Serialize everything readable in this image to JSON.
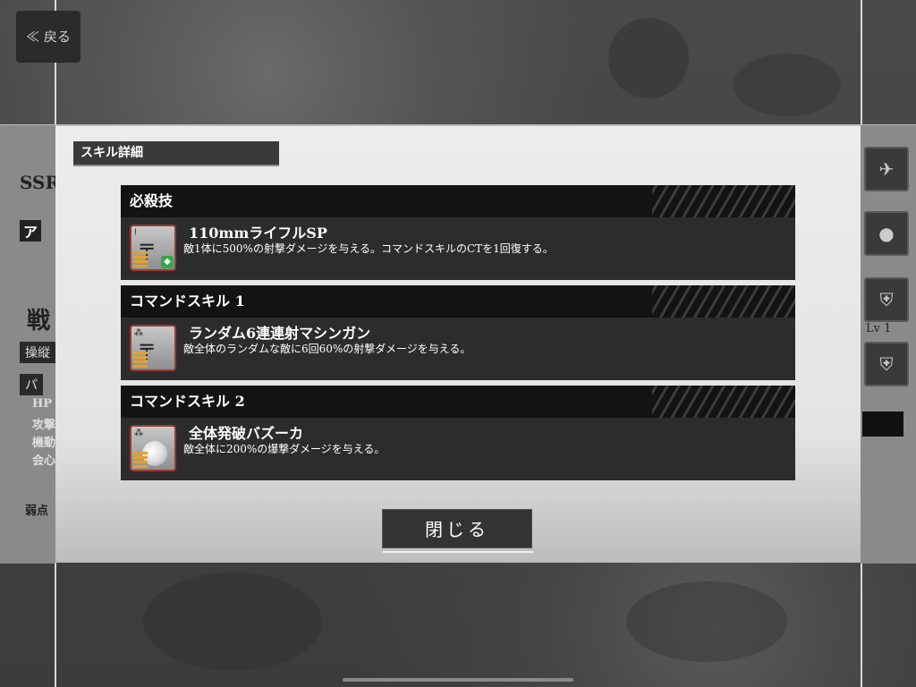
{
  "background": {
    "back_label": "≪ 戻る",
    "left_texts": [
      "SSR",
      "ア",
      "戦",
      "操縦",
      "パ",
      "HP",
      "攻撃",
      "機動",
      "会心",
      "弱点"
    ],
    "right_lv": "Lv    1"
  },
  "dialog": {
    "title": "スキル詳細",
    "close_label": "閉じる",
    "skills": [
      {
        "category": "必殺技",
        "name": "110mmライフルSP",
        "description": "敵1体に500%の射撃ダメージを与える。コマンドスキルのCTを1回復する。",
        "icon": "rifle-icon"
      },
      {
        "category": "コマンドスキル 1",
        "name": "ランダム6連連射マシンガン",
        "description": "敵全体のランダムな敵に6回60%の射撃ダメージを与える。",
        "icon": "machine-gun-icon"
      },
      {
        "category": "コマンドスキル 2",
        "name": "全体発破バズーカ",
        "description": "敵全体に200%の爆撃ダメージを与える。",
        "icon": "bazooka-bomb-icon"
      }
    ]
  }
}
